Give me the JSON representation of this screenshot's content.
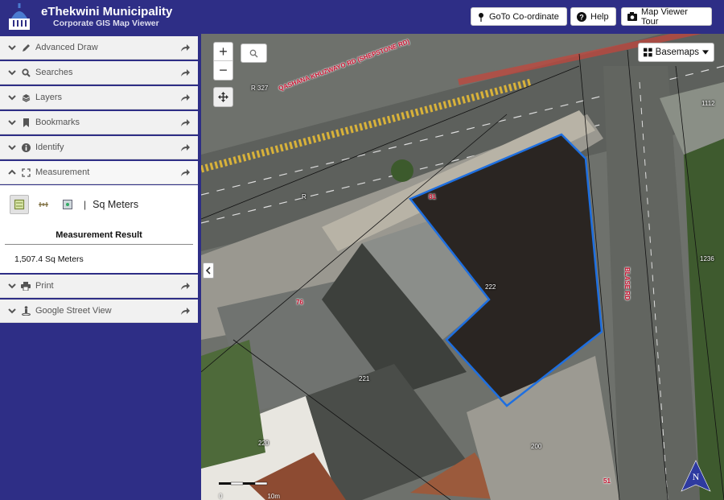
{
  "header": {
    "title": "eThekwini Municipality",
    "subtitle": "Corporate GIS Map Viewer",
    "logo_text": "ETHEKWINI MUNICIPALITY",
    "buttons": {
      "goto": "GoTo Co-ordinate",
      "help": "Help",
      "tour": "Map Viewer Tour"
    }
  },
  "sidebar": {
    "items": [
      {
        "label": "Advanced Draw",
        "icon": "pencil-icon"
      },
      {
        "label": "Searches",
        "icon": "search-icon"
      },
      {
        "label": "Layers",
        "icon": "layers-icon"
      },
      {
        "label": "Bookmarks",
        "icon": "bookmark-icon"
      },
      {
        "label": "Identify",
        "icon": "info-icon"
      },
      {
        "label": "Measurement",
        "icon": "expand-icon",
        "expanded": true
      },
      {
        "label": "Print",
        "icon": "print-icon"
      },
      {
        "label": "Google Street View",
        "icon": "street-view-icon"
      }
    ]
  },
  "measurement": {
    "unit": "Sq Meters",
    "result_title": "Measurement Result",
    "result_value": "1,507.4 Sq Meters",
    "tools": [
      "area-tool-icon",
      "distance-tool-icon",
      "location-tool-icon"
    ]
  },
  "map": {
    "basemaps_label": "Basemaps",
    "zoom_in": "+",
    "zoom_out": "−",
    "labels": {
      "road_main": "QASHANA KHUZWAYO RD (SHEPSTONE RD)",
      "road_blase": "BLASE RD",
      "r327": "R 327",
      "r": "R",
      "p81": "81",
      "p222": "222",
      "p76": "76",
      "p221": "221",
      "p220": "220",
      "p200": "200",
      "p1112": "1112",
      "p1236": "1236",
      "p51": "51"
    },
    "scale": {
      "start": "0",
      "end": "10m"
    },
    "compass": "N"
  },
  "colors": {
    "header_bg": "#2e2e86",
    "sidebar_bg": "#2e2e86",
    "selection": "#1e6fe0"
  }
}
